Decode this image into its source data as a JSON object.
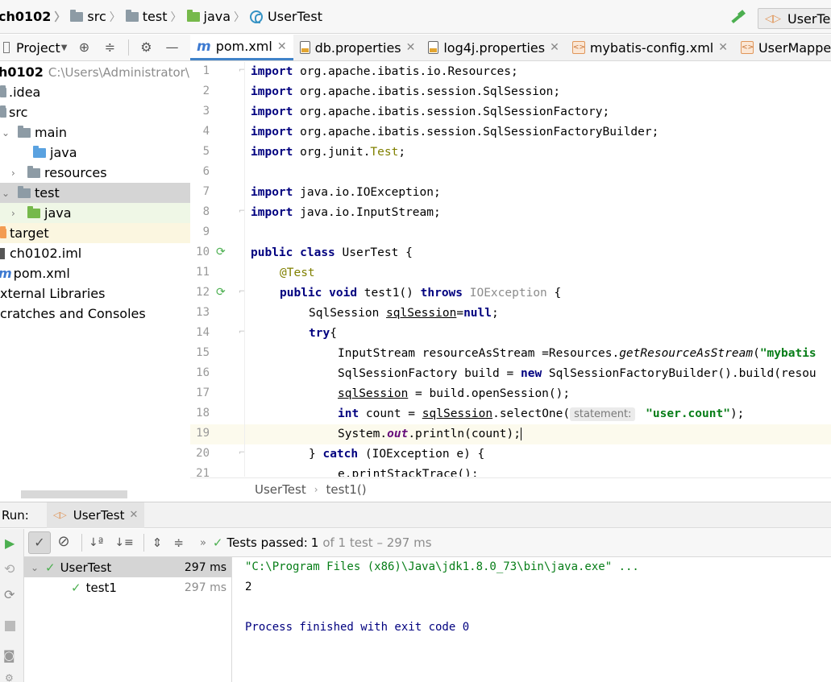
{
  "breadcrumb": {
    "project": "ch0102",
    "items": [
      "src",
      "test",
      "java",
      "UserTest"
    ]
  },
  "run_config": {
    "label": "UserTest"
  },
  "project_panel": {
    "title": "Project"
  },
  "editor_tabs": [
    {
      "label": "pom.xml",
      "icon": "maven-icon"
    },
    {
      "label": "db.properties",
      "icon": "properties-file-icon"
    },
    {
      "label": "log4j.properties",
      "icon": "properties-file-icon"
    },
    {
      "label": "mybatis-config.xml",
      "icon": "xml-file-icon"
    },
    {
      "label": "UserMapper.x",
      "icon": "xml-file-icon"
    }
  ],
  "tree": {
    "root": {
      "name": "h0102",
      "path": "C:\\Users\\Administrator\\Id"
    },
    "items": [
      {
        "label": ".idea"
      },
      {
        "label": "src"
      },
      {
        "label": "main"
      },
      {
        "label": "java"
      },
      {
        "label": "resources"
      },
      {
        "label": "test"
      },
      {
        "label": "java"
      },
      {
        "label": "target"
      },
      {
        "label": "ch0102.iml"
      },
      {
        "label": "pom.xml"
      },
      {
        "label": "xternal Libraries"
      },
      {
        "label": "cratches and Consoles"
      }
    ]
  },
  "line_numbers": [
    "1",
    "2",
    "3",
    "4",
    "5",
    "6",
    "7",
    "8",
    "9",
    "10",
    "11",
    "12",
    "13",
    "14",
    "15",
    "16",
    "17",
    "18",
    "19",
    "20",
    "21"
  ],
  "code": {
    "l1": {
      "kw": "import",
      "rest": " org.apache.ibatis.io.Resources;"
    },
    "l2": {
      "kw": "import",
      "rest": " org.apache.ibatis.session.SqlSession;"
    },
    "l3": {
      "kw": "import",
      "rest": " org.apache.ibatis.session.SqlSessionFactory;"
    },
    "l4": {
      "kw": "import",
      "rest": " org.apache.ibatis.session.SqlSessionFactoryBuilder;"
    },
    "l5": {
      "kw": "import",
      "a": " org.junit.",
      "b": "Test",
      "c": ";"
    },
    "l7": {
      "kw": "import",
      "rest": " java.io.IOException;"
    },
    "l8": {
      "kw": "import",
      "rest": " java.io.InputStream;"
    },
    "l10": {
      "kw1": "public",
      "kw2": "class",
      "rest": " UserTest {"
    },
    "l11": {
      "ann": "@Test"
    },
    "l12": {
      "kw1": "public",
      "kw2": "void",
      "mid": " test1() ",
      "kw3": "throws",
      "gray": " IOException",
      "rest": " {"
    },
    "l13": {
      "a": "SqlSession ",
      "var": "sqlSession",
      "b": "=",
      "kw": "null",
      "c": ";"
    },
    "l14": {
      "kw": "try",
      "rest": "{"
    },
    "l15": {
      "a": "InputStream resourceAsStream =Resources.",
      "it": "getResourceAsStream",
      "b": "(",
      "str": "\"mybatis"
    },
    "l16": {
      "a": "SqlSessionFactory build = ",
      "kw": "new",
      "b": " SqlSessionFactoryBuilder().build(resou"
    },
    "l17": {
      "var": "sqlSession",
      "a": " = build.openSession();"
    },
    "l18": {
      "kw": "int",
      "a": " count = ",
      "var": "sqlSession",
      "b": ".selectOne(",
      "hint": "statement:",
      "str": " \"user.count\"",
      "c": ");"
    },
    "l19": {
      "a": "System.",
      "stat": "out",
      "b": ".println(count);"
    },
    "l20": {
      "a": "} ",
      "kw": "catch",
      "b": " (IOException e) {"
    },
    "l21": {
      "a": "e.printStackTrace();"
    }
  },
  "editor_breadcrumb": [
    "UserTest",
    "test1()"
  ],
  "run_panel": {
    "label": "Run:",
    "tab": "UserTest",
    "status": {
      "prefix": "Tests passed:",
      "count": "1",
      "suffix": "of 1 test – 297 ms"
    },
    "tests": [
      {
        "name": "UserTest",
        "time": "297 ms"
      },
      {
        "name": "test1",
        "time": "297 ms"
      }
    ],
    "console": [
      "\"C:\\Program Files (x86)\\Java\\jdk1.8.0_73\\bin\\java.exe\" ...",
      "2",
      "",
      "Process finished with exit code 0"
    ]
  },
  "colors": {
    "accent": "#4083c9",
    "keyword": "#00007f",
    "string": "#067d17",
    "success": "#4caf50"
  }
}
